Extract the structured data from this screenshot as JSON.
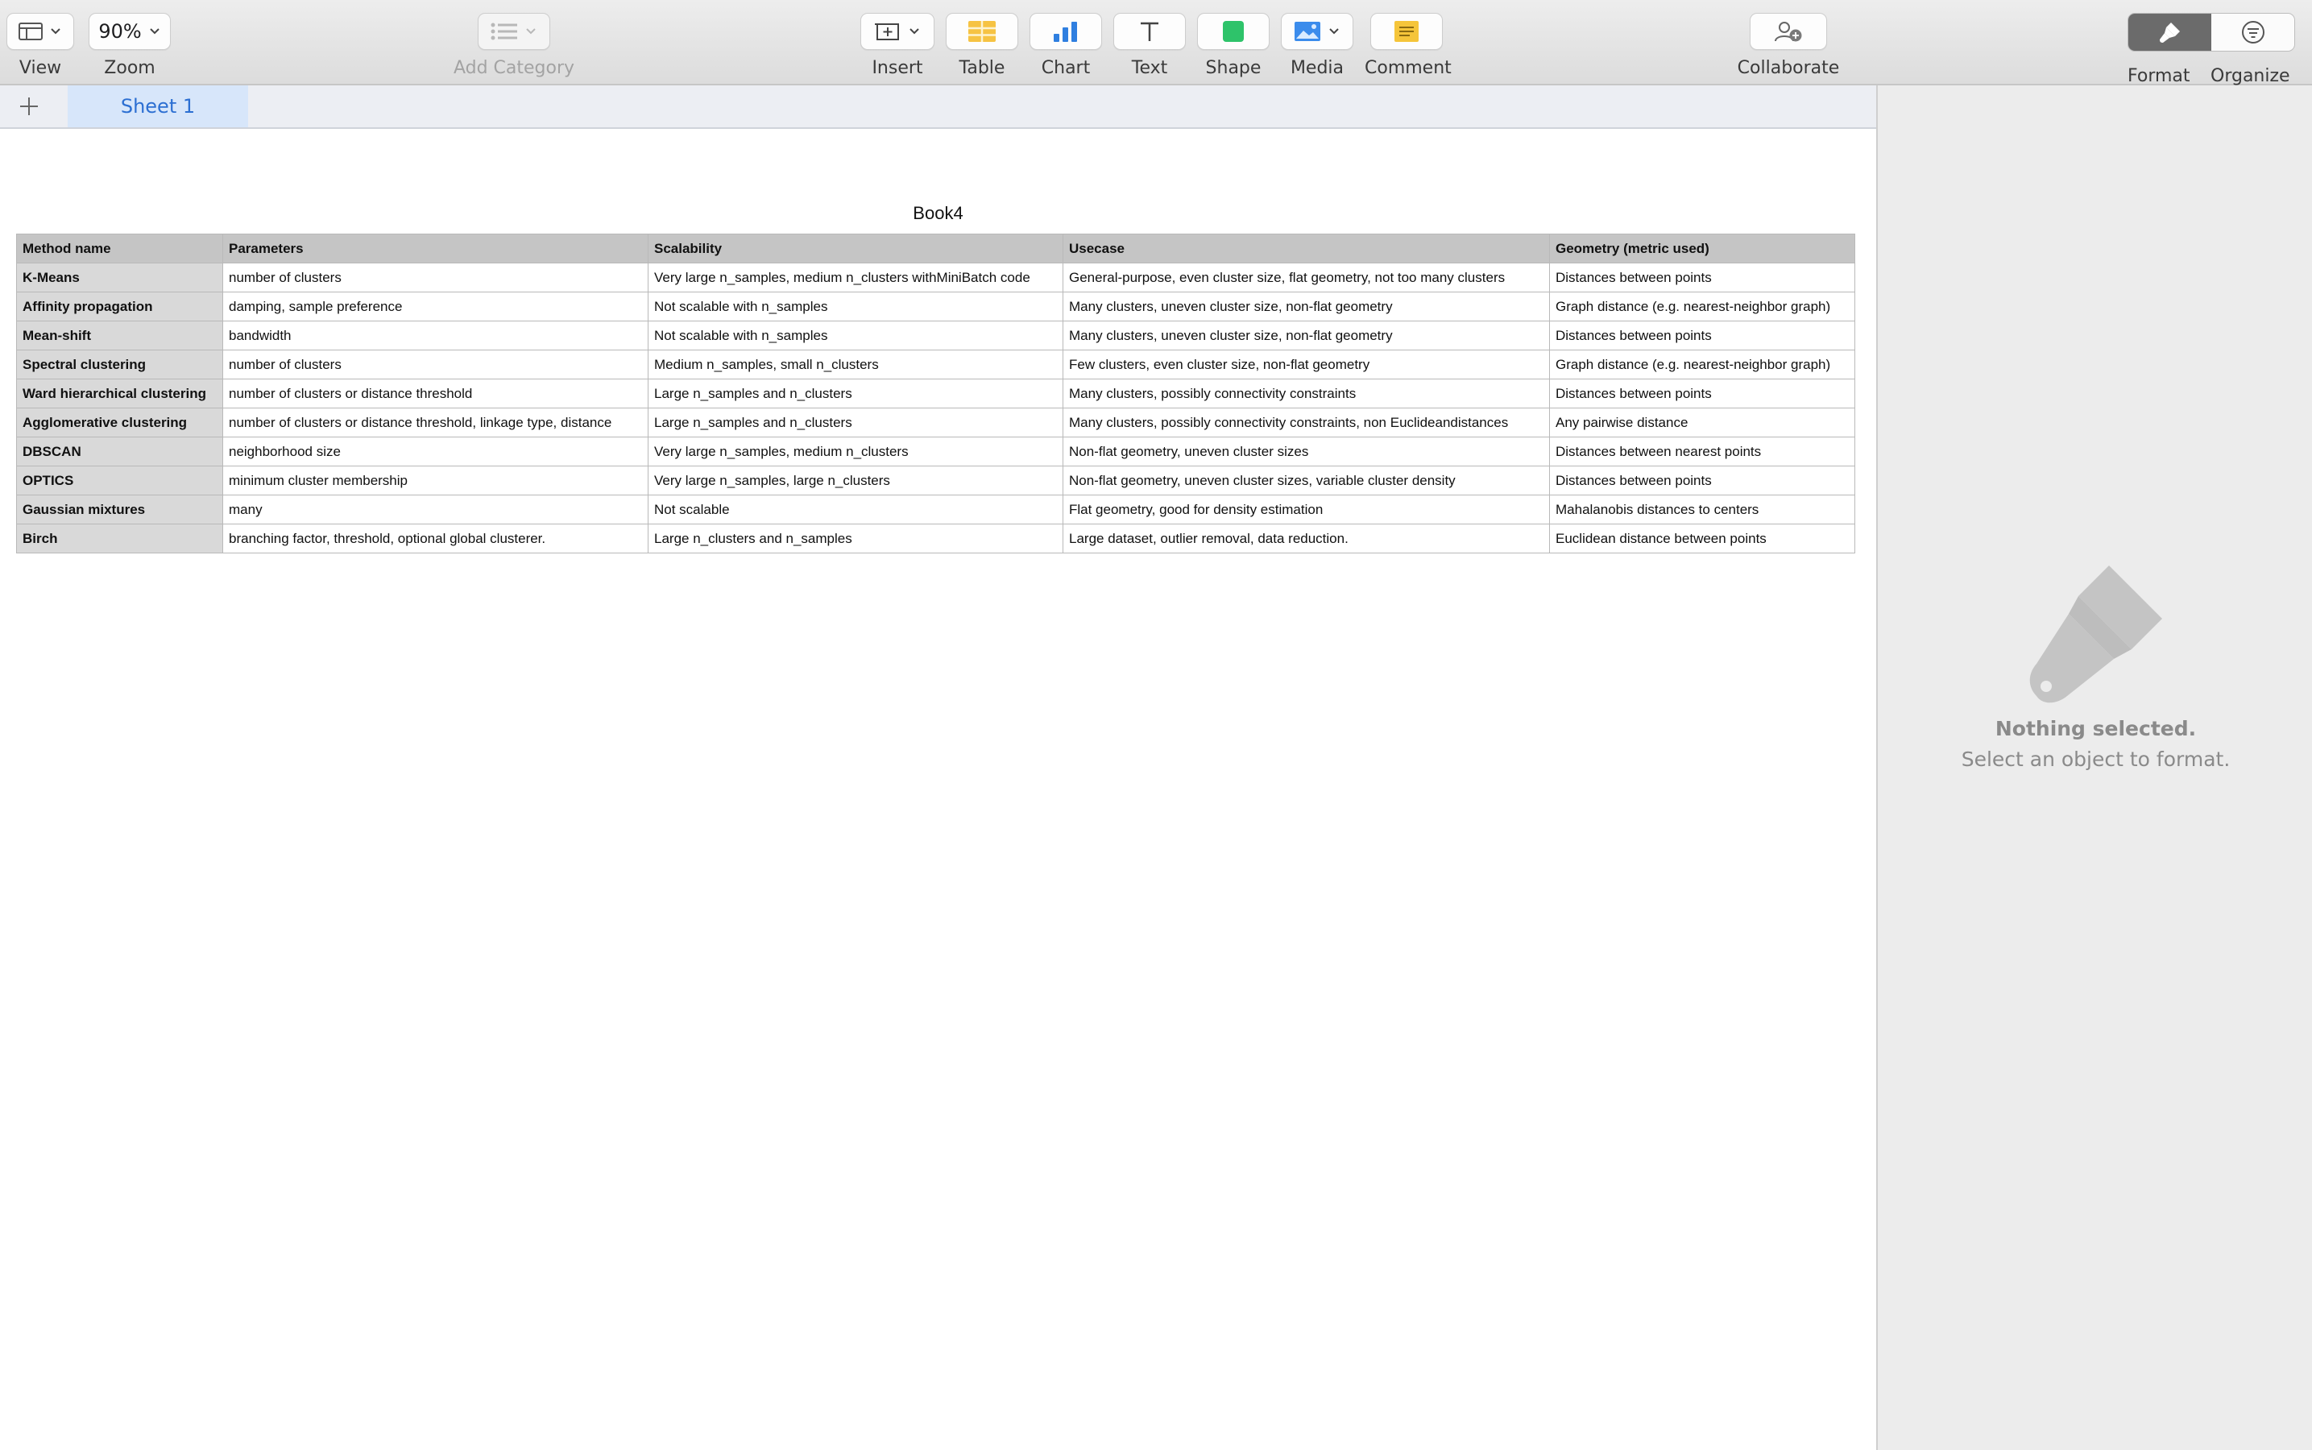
{
  "toolbar": {
    "view_label": "View",
    "zoom_value": "90%",
    "zoom_label": "Zoom",
    "add_category_label": "Add Category",
    "insert_label": "Insert",
    "table_label": "Table",
    "chart_label": "Chart",
    "text_label": "Text",
    "shape_label": "Shape",
    "media_label": "Media",
    "comment_label": "Comment",
    "collaborate_label": "Collaborate",
    "format_label": "Format",
    "organize_label": "Organize"
  },
  "sheets": [
    "Sheet 1"
  ],
  "table": {
    "title": "Book4",
    "headers": [
      "Method name",
      "Parameters",
      "Scalability",
      "Usecase",
      "Geometry (metric used)"
    ],
    "rows": [
      [
        "K-Means",
        "number of clusters",
        "Very large n_samples, medium n_clusters withMiniBatch code",
        "General-purpose, even cluster size, flat geometry, not too many clusters",
        "Distances between points"
      ],
      [
        "Affinity propagation",
        "damping, sample preference",
        "Not scalable with n_samples",
        "Many clusters, uneven cluster size, non-flat geometry",
        "Graph distance (e.g. nearest-neighbor graph)"
      ],
      [
        "Mean-shift",
        "bandwidth",
        "Not scalable with n_samples",
        "Many clusters, uneven cluster size, non-flat geometry",
        "Distances between points"
      ],
      [
        "Spectral clustering",
        "number of clusters",
        "Medium n_samples, small n_clusters",
        "Few clusters, even cluster size, non-flat geometry",
        "Graph distance (e.g. nearest-neighbor graph)"
      ],
      [
        "Ward hierarchical clustering",
        "number of clusters or distance threshold",
        "Large n_samples and n_clusters",
        "Many clusters, possibly connectivity constraints",
        "Distances between points"
      ],
      [
        "Agglomerative clustering",
        "number of clusters or distance threshold, linkage type, distance",
        "Large n_samples and n_clusters",
        "Many clusters, possibly connectivity constraints, non Euclideandistances",
        "Any pairwise distance"
      ],
      [
        "DBSCAN",
        "neighborhood size",
        "Very large n_samples, medium n_clusters",
        "Non-flat geometry, uneven cluster sizes",
        "Distances between nearest points"
      ],
      [
        "OPTICS",
        "minimum cluster membership",
        "Very large n_samples, large n_clusters",
        "Non-flat geometry, uneven cluster sizes, variable cluster density",
        "Distances between points"
      ],
      [
        "Gaussian mixtures",
        "many",
        "Not scalable",
        "Flat geometry, good for density estimation",
        "Mahalanobis distances to  centers"
      ],
      [
        "Birch",
        "branching factor, threshold, optional global clusterer.",
        "Large n_clusters and n_samples",
        "Large dataset, outlier removal, data reduction.",
        "Euclidean distance between points"
      ]
    ]
  },
  "inspector": {
    "title": "Nothing selected.",
    "hint": "Select an object to format.",
    "icon": "paintbrush-icon"
  }
}
